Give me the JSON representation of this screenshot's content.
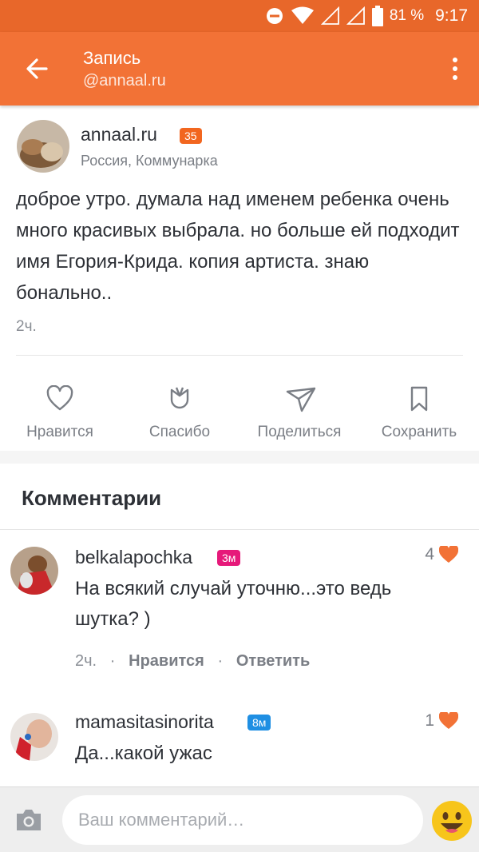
{
  "status_bar": {
    "battery_percent": "81 %",
    "time": "9:17"
  },
  "header": {
    "title": "Запись",
    "subtitle": "@annaal.ru"
  },
  "post": {
    "author": "annaal.ru",
    "author_badge": "35",
    "location": "Россия, Коммунарка",
    "text": "доброе утро. думала над именем ребенка очень много красивых выбрала. но больше ей подходит имя Егория-Крида. копия артиста. знаю бонально..",
    "time": "2ч."
  },
  "actions": {
    "like": "Нравится",
    "thanks": "Спасибо",
    "share": "Поделиться",
    "save": "Сохранить"
  },
  "comments_section": {
    "title": "Комментарии"
  },
  "comments": [
    {
      "author": "belkalapochka",
      "badge": "3м",
      "badge_color": "#e6197a",
      "text": "На всякий случай уточню...это ведь шутка? )",
      "likes": "4",
      "time": "2ч.",
      "like_label": "Нравится",
      "reply_label": "Ответить"
    },
    {
      "author": "mamasitasinorita",
      "badge": "8м",
      "badge_color": "#1f8fe3",
      "text": "Да...какой ужас",
      "likes": "1"
    }
  ],
  "composer": {
    "placeholder": "Ваш комментарий…"
  },
  "colors": {
    "accent": "#f27236",
    "status_bar": "#e8672a",
    "badge_orange": "#f2661f",
    "heart": "#f27236"
  },
  "icons": {
    "back": "arrow-left-icon",
    "menu": "more-vertical-icon",
    "like": "heart-outline-icon",
    "thanks": "tulip-icon",
    "share": "paper-plane-icon",
    "save": "bookmark-icon",
    "camera": "camera-icon",
    "smile": "smiley-icon"
  }
}
